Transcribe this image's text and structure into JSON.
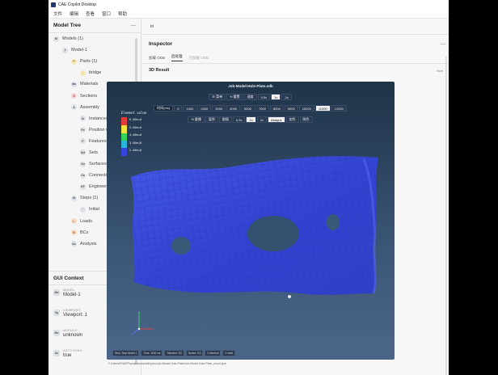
{
  "app": {
    "title": "CAE Copilot Desktop",
    "menu": [
      "文件",
      "编辑",
      "查看",
      "窗口",
      "帮助"
    ]
  },
  "model_tree": {
    "title": "Model Tree",
    "items": [
      {
        "label": "Models (1)",
        "badge": "M",
        "depth": 0,
        "color": "gray"
      },
      {
        "label": "Model-1",
        "badge": "1",
        "depth": 1,
        "color": "gray"
      },
      {
        "label": "Parts (1)",
        "badge": "P",
        "depth": 2,
        "color": "yellow"
      },
      {
        "label": "bridge",
        "badge": "·",
        "depth": 3,
        "color": "yellow"
      },
      {
        "label": "Materials",
        "badge": "Ma",
        "depth": 2,
        "color": "gray"
      },
      {
        "label": "Sections",
        "badge": "S",
        "depth": 2,
        "color": "pink"
      },
      {
        "label": "Assembly",
        "badge": "A",
        "depth": 2,
        "color": "gray"
      },
      {
        "label": "Instances",
        "badge": "In",
        "depth": 3,
        "color": "gray"
      },
      {
        "label": "Position Cons...",
        "badge": "Pc",
        "depth": 3,
        "color": "gray"
      },
      {
        "label": "Features",
        "badge": "F",
        "depth": 3,
        "color": "gray"
      },
      {
        "label": "Sets",
        "badge": "Set",
        "depth": 3,
        "color": "gray"
      },
      {
        "label": "Surfaces",
        "badge": "Su",
        "depth": 3,
        "color": "gray"
      },
      {
        "label": "Connector As...",
        "badge": "Ca",
        "depth": 3,
        "color": "gray"
      },
      {
        "label": "Engineering F...",
        "badge": "EF",
        "depth": 3,
        "color": "gray"
      },
      {
        "label": "Steps (1)",
        "badge": "St",
        "depth": 2,
        "color": "gray"
      },
      {
        "label": "Initial",
        "badge": "·",
        "depth": 3,
        "color": "gray"
      },
      {
        "label": "Loads",
        "badge": "L",
        "depth": 2,
        "color": "orange"
      },
      {
        "label": "BCs",
        "badge": "B",
        "depth": 2,
        "color": "orange"
      },
      {
        "label": "Analysis",
        "badge": "An",
        "depth": 2,
        "color": "gray"
      }
    ]
  },
  "gui_context": {
    "title": "GUI Context",
    "items": [
      {
        "badge": "Md",
        "label": "MODEL:",
        "value": "Model-1"
      },
      {
        "badge": "Vp",
        "label": "VIEWPORT:",
        "value": "Viewport: 1"
      },
      {
        "badge": "Mo",
        "label": "MODULE:",
        "value": "unknown"
      },
      {
        "badge": "As",
        "label": "AUTO SYNC:",
        "value": "true"
      }
    ]
  },
  "top_tab": "io",
  "inspector": {
    "title": "Inspector",
    "tabs": [
      "加载 ODB",
      "后处理",
      "已加载 ODB"
    ],
    "active_tab": 1
  },
  "result": {
    "title": "3D Result",
    "hide_label": "Hide",
    "job_title": "Job-Model-Hole-Plate.odb",
    "row1": [
      "☰ 菜单",
      "⟲ 重置",
      "速度",
      "0.5x",
      "1x",
      "2x"
    ],
    "row1_active": 4,
    "row2_label": "时间(ms)",
    "row2": [
      "0",
      "1000",
      "2000",
      "3000",
      "4000",
      "5000",
      "7000",
      "8000",
      "9000",
      "10000",
      "11000",
      "12000"
    ],
    "row2_active": 10,
    "row3": [
      "⟲ 重播",
      "暂停",
      "跟随",
      "0.5x",
      "1x",
      "2x",
      "Abaqus",
      "加色",
      "隐色"
    ],
    "row3_active": [
      4,
      6
    ],
    "legend_title": "Element value",
    "legend_values": [
      "6.00e+0",
      "5.00e+0",
      "4.00e+0",
      "3.00e+0",
      "2.00e+0"
    ],
    "status": [
      "Step: Step-Model-1",
      "Time: 1000 ms",
      "Selected: 0/0",
      "Nodes: 0/0",
      "0 element",
      "0 node"
    ],
    "path": "F:\\Users\\FNAPP\\projects\\workdir\\jobs\\Job-Model-Hole-Plate\\Job-Model-Hole-Plate_result.json"
  },
  "colors": {
    "mesh": "#3a4bd6",
    "viewport_top": "#1f3348",
    "viewport_bottom": "#4b6689"
  }
}
